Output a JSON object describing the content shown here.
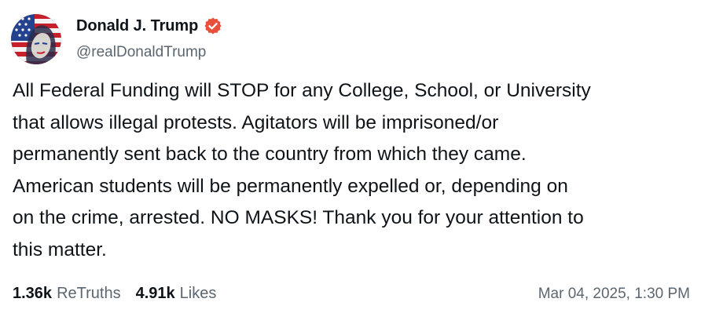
{
  "post": {
    "author": {
      "display_name": "Donald J. Trump",
      "handle": "@realDonaldTrump",
      "verified_icon": "verified-badge-icon",
      "verified_color": "#e8503a",
      "avatar_icon": "user-avatar"
    },
    "body": "All Federal Funding will STOP for any College, School, or University\nthat allows illegal protests. Agitators will be imprisoned/or\npermanently sent back to the country from which they came.\nAmerican students will be permanently expelled or, depending on\non the crime, arrested. NO MASKS! Thank you for your attention to\nthis matter.",
    "stats": {
      "retruths_count": "1.36k",
      "retruths_label": "ReTruths",
      "likes_count": "4.91k",
      "likes_label": "Likes"
    },
    "timestamp": "Mar 04, 2025, 1:30 PM"
  },
  "colors": {
    "text_primary": "#0f1419",
    "text_secondary": "#5b6670",
    "background": "#ffffff"
  }
}
